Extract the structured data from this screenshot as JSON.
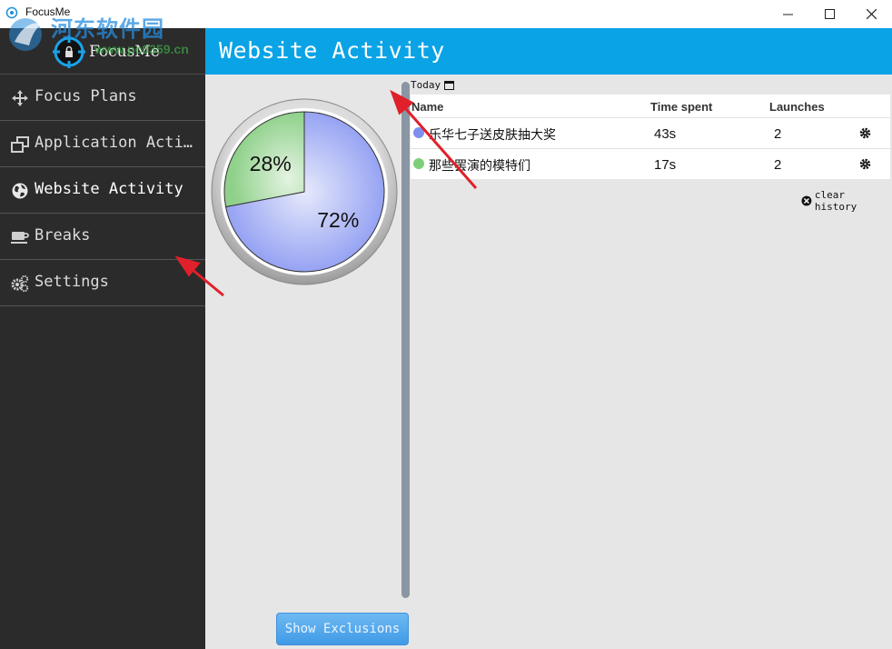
{
  "window": {
    "title": "FocusMe"
  },
  "watermark": {
    "text": "河东软件园",
    "url": "www.pc0359.cn"
  },
  "sidebar": {
    "brand": "FocusMe",
    "items": [
      {
        "label": "Focus Plans",
        "icon": "arrows-move-icon"
      },
      {
        "label": "Application Acti…",
        "icon": "windows-icon"
      },
      {
        "label": "Website Activity",
        "icon": "globe-icon",
        "active": true
      },
      {
        "label": "Breaks",
        "icon": "coffee-cup-icon"
      },
      {
        "label": "Settings",
        "icon": "gears-icon"
      }
    ]
  },
  "header": {
    "title": "Website Activity"
  },
  "pie": {
    "slices": [
      {
        "label": "72%",
        "value": 72,
        "color": "#8e9cf2"
      },
      {
        "label": "28%",
        "value": 28,
        "color": "#8fd18a"
      }
    ]
  },
  "date_filter": {
    "label": "Today"
  },
  "table": {
    "columns": [
      "Name",
      "Time spent",
      "Launches"
    ],
    "rows": [
      {
        "name": "乐华七子送皮肤抽大奖",
        "time": "43s",
        "launches": "2",
        "color": "#7f8ff0"
      },
      {
        "name": "那些罢演的模特们",
        "time": "17s",
        "launches": "2",
        "color": "#7fcf7a"
      }
    ]
  },
  "clear_history": "clear history",
  "show_exclusions": "Show Exclusions",
  "colors": {
    "header": "#0aa3e6",
    "sidebar": "#2b2b2b",
    "annotation_arrow": "#e0202a"
  }
}
